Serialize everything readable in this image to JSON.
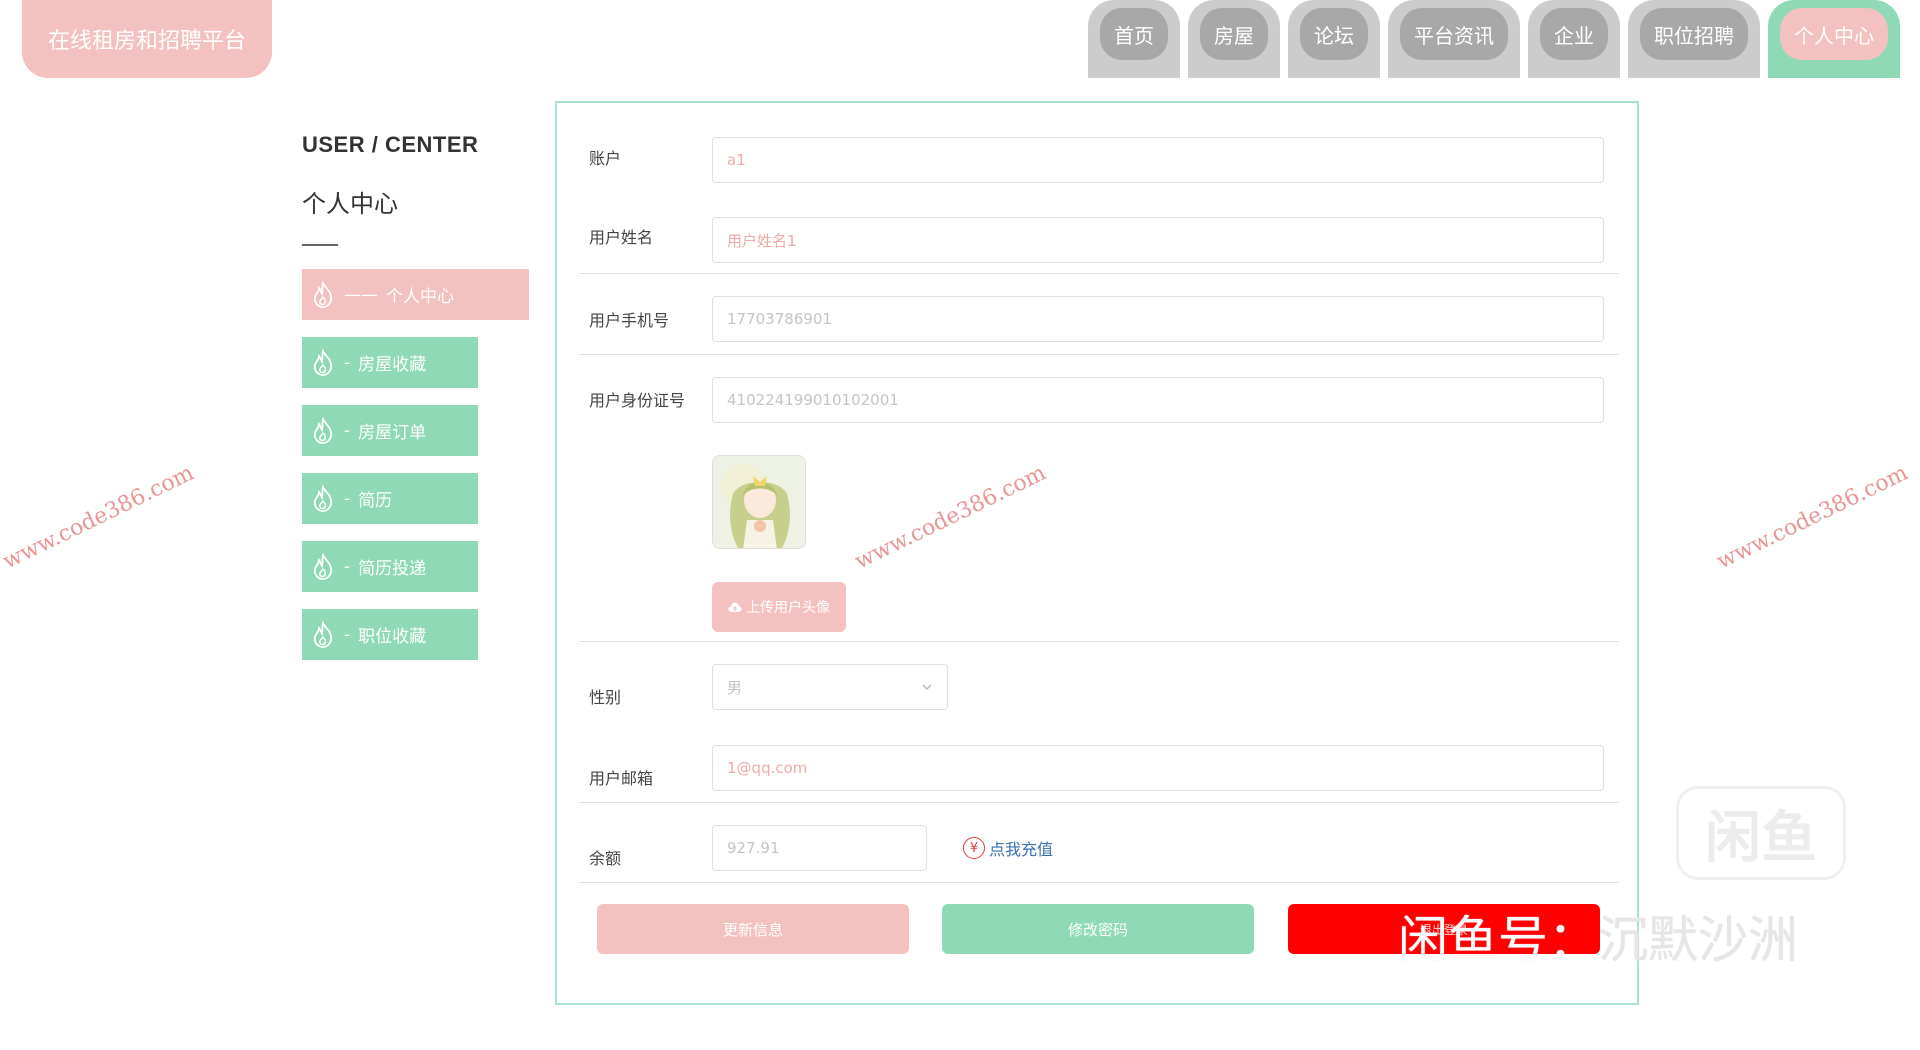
{
  "brand": {
    "title": "在线租房和招聘平台"
  },
  "nav": {
    "items": [
      {
        "label": "首页"
      },
      {
        "label": "房屋"
      },
      {
        "label": "论坛"
      },
      {
        "label": "平台资讯"
      },
      {
        "label": "企业"
      },
      {
        "label": "职位招聘"
      },
      {
        "label": "个人中心",
        "active": true
      }
    ]
  },
  "sidebar": {
    "title_en": "USER / CENTER",
    "title_cn": "个人中心",
    "items": [
      {
        "label": "个人中心",
        "prefix": "——",
        "active": true
      },
      {
        "label": "房屋收藏",
        "prefix": "-"
      },
      {
        "label": "房屋订单",
        "prefix": "-"
      },
      {
        "label": "简历",
        "prefix": "-"
      },
      {
        "label": "简历投递",
        "prefix": "-"
      },
      {
        "label": "职位收藏",
        "prefix": "-"
      }
    ]
  },
  "form": {
    "account": {
      "label": "账户",
      "value": "a1"
    },
    "username": {
      "label": "用户姓名",
      "value": "用户姓名1"
    },
    "phone": {
      "label": "用户手机号",
      "value": "17703786901"
    },
    "idcard": {
      "label": "用户身份证号",
      "value": "410224199010102001"
    },
    "avatar": {
      "upload_label": "上传用户头像"
    },
    "gender": {
      "label": "性别",
      "value": "男"
    },
    "email": {
      "label": "用户邮箱",
      "value": "1@qq.com"
    },
    "balance": {
      "label": "余额",
      "value": "927.91",
      "recharge_label": "点我充值",
      "currency_symbol": "¥"
    },
    "buttons": {
      "update": "更新信息",
      "password": "修改密码",
      "logout": "退出登录"
    }
  },
  "watermarks": {
    "site": "www.code386.com",
    "xianyu_logo": "闲鱼",
    "xianyu_text_left": "闲鱼号：",
    "xianyu_text_right": "沉默沙洲"
  },
  "colors": {
    "pink": "#f4c1c1",
    "green": "#8fd9b6",
    "gray_tab": "#cccccc",
    "red": "#ff0000",
    "link_blue": "#3a6fb0"
  }
}
